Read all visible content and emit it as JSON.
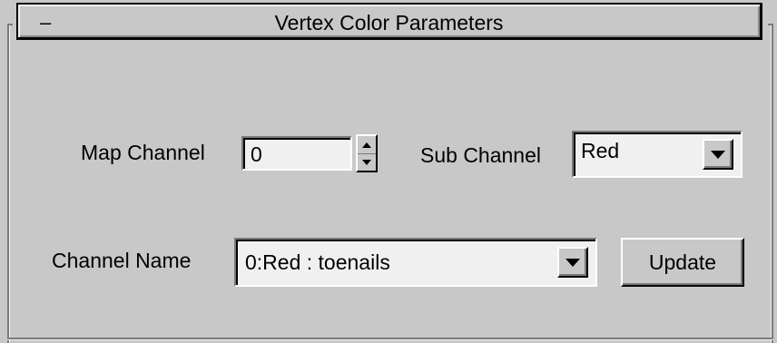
{
  "rollout": {
    "title": "Vertex Color Parameters",
    "collapse_symbol": "–"
  },
  "map_channel": {
    "label": "Map Channel",
    "value": "0"
  },
  "sub_channel": {
    "label": "Sub Channel",
    "selected": "Red"
  },
  "channel_name": {
    "label": "Channel Name",
    "selected": "0:Red : toenails"
  },
  "update_button": {
    "label": "Update"
  },
  "icons": {
    "collapse": "minus-icon",
    "spinner_up": "triangle-up-icon",
    "spinner_down": "triangle-down-icon",
    "dropdown": "chevron-down-icon"
  },
  "colors": {
    "panel_bg": "#c8c8c8",
    "field_bg": "#f0f0f0"
  }
}
